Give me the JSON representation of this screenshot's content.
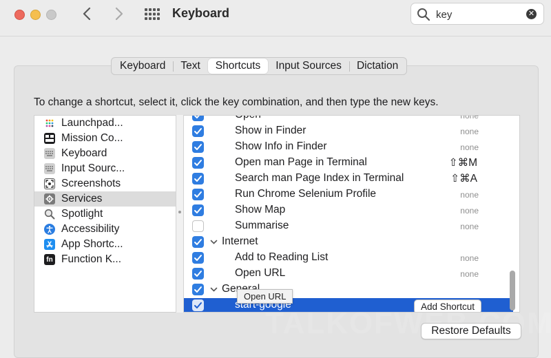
{
  "window": {
    "title": "Keyboard"
  },
  "search": {
    "value": "key"
  },
  "tabs": [
    {
      "label": "Keyboard",
      "active": false
    },
    {
      "label": "Text",
      "active": false
    },
    {
      "label": "Shortcuts",
      "active": true
    },
    {
      "label": "Input Sources",
      "active": false
    },
    {
      "label": "Dictation",
      "active": false
    }
  ],
  "instruction": "To change a shortcut, select it, click the key combination, and then type the new keys.",
  "categories": [
    {
      "label": "Launchpad...",
      "icon": "launchpad-icon",
      "selected": false
    },
    {
      "label": "Mission Co...",
      "icon": "mission-control-icon",
      "selected": false
    },
    {
      "label": "Keyboard",
      "icon": "keyboard-icon",
      "selected": false
    },
    {
      "label": "Input Sourc...",
      "icon": "input-sources-icon",
      "selected": false
    },
    {
      "label": "Screenshots",
      "icon": "screenshots-icon",
      "selected": false
    },
    {
      "label": "Services",
      "icon": "gear-icon",
      "selected": true
    },
    {
      "label": "Spotlight",
      "icon": "spotlight-icon",
      "selected": false
    },
    {
      "label": "Accessibility",
      "icon": "accessibility-icon",
      "selected": false
    },
    {
      "label": "App Shortc...",
      "icon": "app-store-icon",
      "selected": false
    },
    {
      "label": "Function K...",
      "icon": "fn-key-icon",
      "selected": false
    }
  ],
  "shortcuts": [
    {
      "label": "Open",
      "shortcut": "none",
      "checked": true,
      "group": false
    },
    {
      "label": "Show in Finder",
      "shortcut": "none",
      "checked": true,
      "group": false
    },
    {
      "label": "Show Info in Finder",
      "shortcut": "none",
      "checked": true,
      "group": false
    },
    {
      "label": "Open man Page in Terminal",
      "shortcut": "⇧⌘M",
      "checked": true,
      "group": false
    },
    {
      "label": "Search man Page Index in Terminal",
      "shortcut": "⇧⌘A",
      "checked": true,
      "group": false
    },
    {
      "label": "Run Chrome Selenium Profile",
      "shortcut": "none",
      "checked": true,
      "group": false
    },
    {
      "label": "Show Map",
      "shortcut": "none",
      "checked": true,
      "group": false
    },
    {
      "label": "Summarise",
      "shortcut": "none",
      "checked": false,
      "group": false
    },
    {
      "label": "Internet",
      "shortcut": "",
      "checked": true,
      "group": true
    },
    {
      "label": "Add to Reading List",
      "shortcut": "none",
      "checked": true,
      "group": false
    },
    {
      "label": "Open URL",
      "shortcut": "none",
      "checked": true,
      "group": false
    },
    {
      "label": "General",
      "shortcut": "",
      "checked": true,
      "group": true
    },
    {
      "label": "start-google",
      "shortcut": "",
      "checked": true,
      "group": false,
      "selected": true
    }
  ],
  "add_shortcut_label": "Add Shortcut",
  "tooltip": "Open URL",
  "restore_defaults": "Restore Defaults",
  "watermark": "TALKOFWEB.COM",
  "colors": {
    "accent": "#2f7de1",
    "selection": "#1f5fd1",
    "window_bg": "#ececec"
  }
}
